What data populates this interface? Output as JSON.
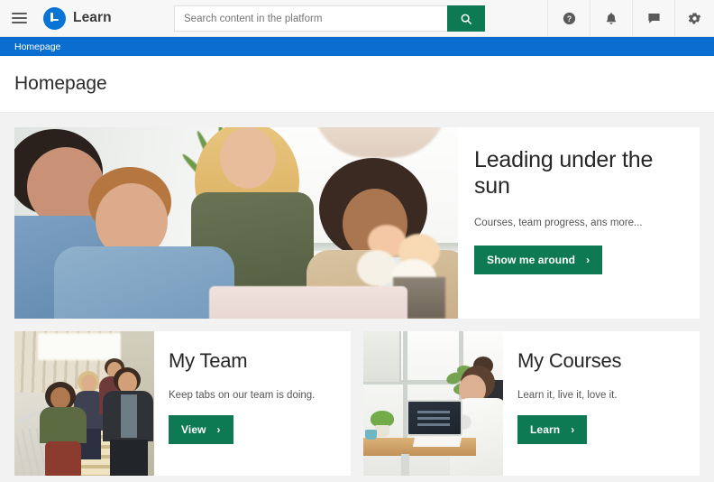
{
  "topbar": {
    "menu_icon": "hamburger-menu-icon",
    "logo_icon": "learn-logo-icon",
    "brand_name": "Learn",
    "search": {
      "placeholder": "Search content in the platform",
      "value": "",
      "button_icon": "search-icon"
    },
    "actions": [
      {
        "name": "help-icon",
        "glyph": "?"
      },
      {
        "name": "notifications-bell-icon",
        "glyph": "bell"
      },
      {
        "name": "messages-chat-icon",
        "glyph": "chat"
      },
      {
        "name": "settings-gear-icon",
        "glyph": "gear"
      }
    ]
  },
  "breadcrumb": {
    "items": [
      {
        "label": "Homepage"
      }
    ]
  },
  "page": {
    "title": "Homepage"
  },
  "hero": {
    "image_alt": "colleagues-smiling-around-laptop-photo",
    "heading": "Leading under the sun",
    "subtitle": "Courses, team progress, ans more...",
    "button_label": "Show me around",
    "button_chevron": "›"
  },
  "cards": [
    {
      "image_alt": "team-walking-down-stairs-photo",
      "heading": "My Team",
      "subtitle": "Keep tabs on our team is doing.",
      "button_label": "View",
      "button_chevron": "›"
    },
    {
      "image_alt": "woman-studying-at-laptop-photo",
      "heading": "My Courses",
      "subtitle": "Learn it, live it, love it.",
      "button_label": "Learn",
      "button_chevron": "›"
    }
  ],
  "colors": {
    "brand_blue": "#0a73d6",
    "breadcrumb_blue": "#0a6ed1",
    "accent_green": "#0d7a53",
    "page_background": "#f2f2f2",
    "card_background": "#ffffff",
    "topbar_background": "#f7f7f7"
  }
}
